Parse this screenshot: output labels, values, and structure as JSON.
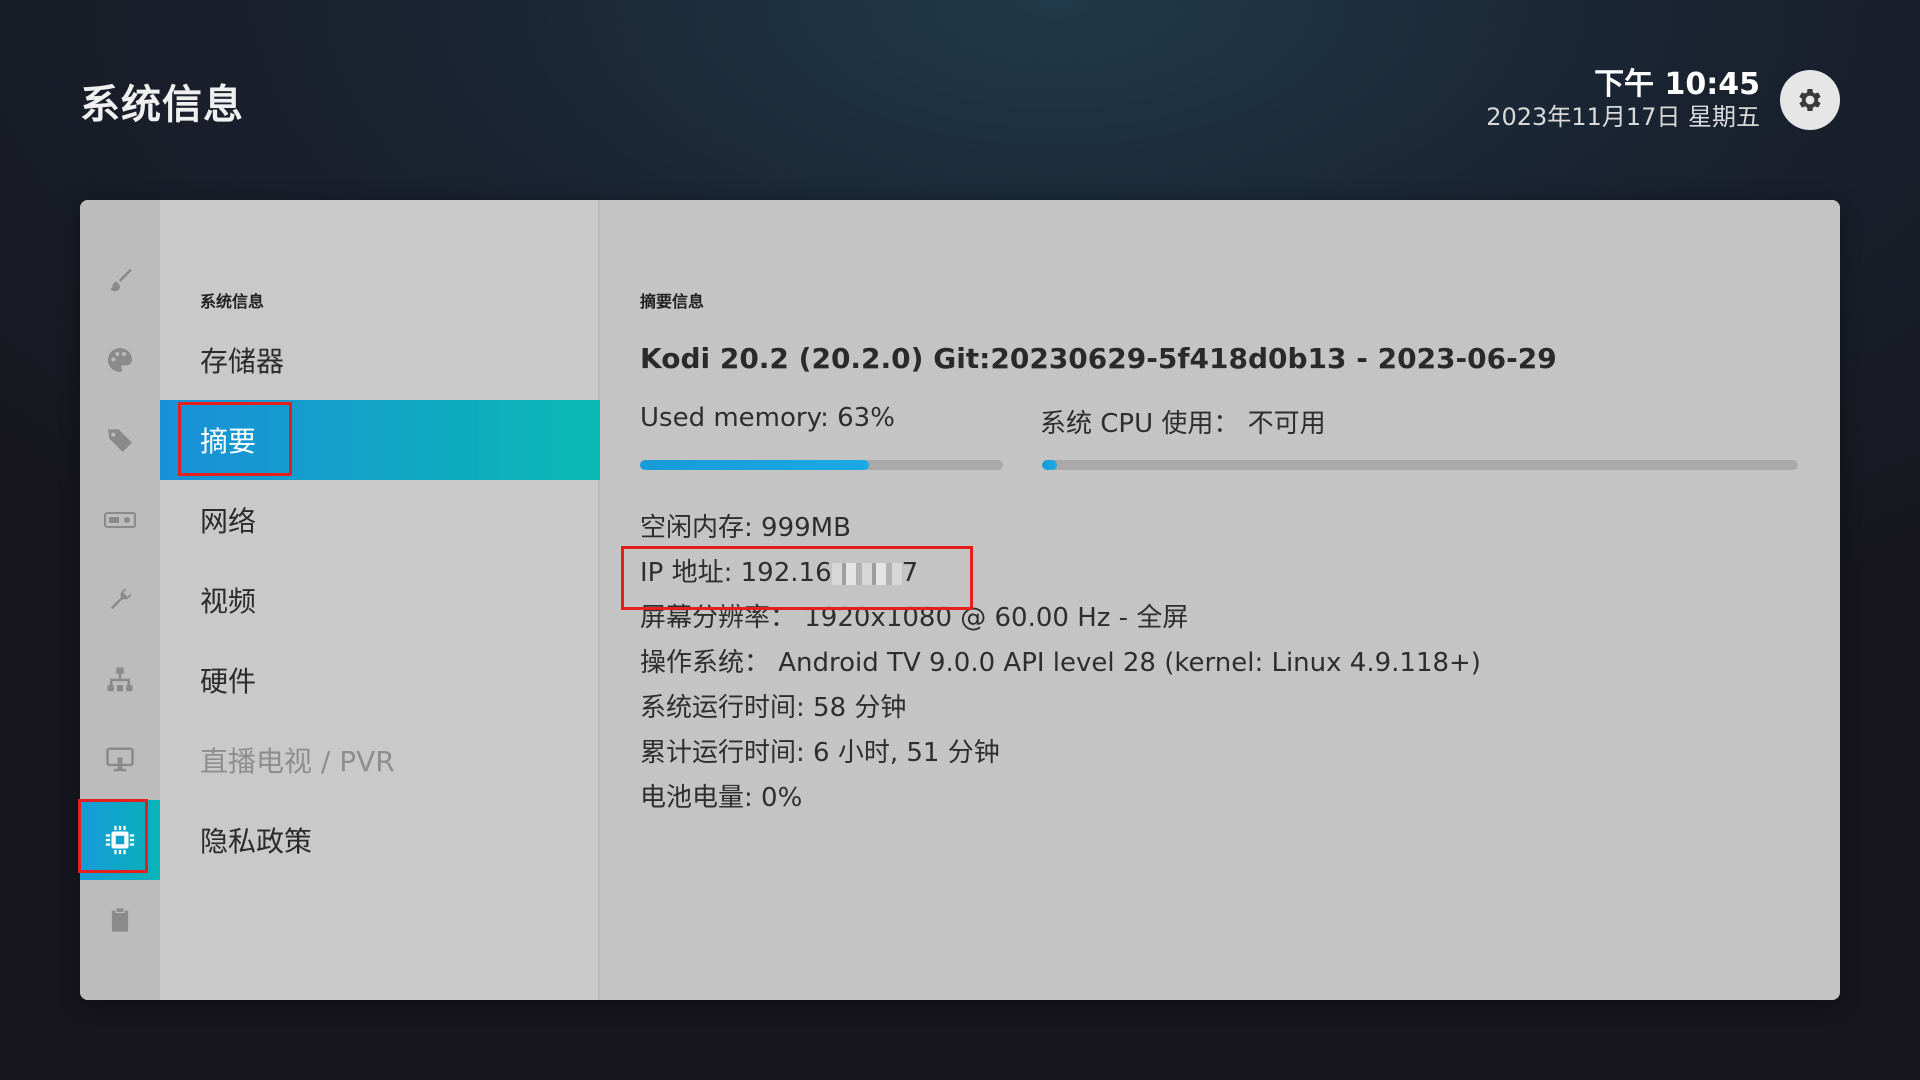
{
  "header": {
    "title": "系统信息",
    "time": "下午 10:45",
    "date": "2023年11月17日 星期五"
  },
  "iconbar": {
    "items": [
      {
        "icon": "paintbrush-icon"
      },
      {
        "icon": "palette-icon"
      },
      {
        "icon": "tags-icon"
      },
      {
        "icon": "media-icon"
      },
      {
        "icon": "wrench-icon"
      },
      {
        "icon": "network-icon"
      },
      {
        "icon": "display-icon"
      },
      {
        "icon": "chip-icon",
        "active": true
      },
      {
        "icon": "clipboard-icon"
      }
    ]
  },
  "menu": {
    "header": "系统信息",
    "items": [
      {
        "label": "存储器"
      },
      {
        "label": "摘要",
        "active": true
      },
      {
        "label": "网络"
      },
      {
        "label": "视频"
      },
      {
        "label": "硬件"
      },
      {
        "label": "直播电视 / PVR",
        "disabled": true
      },
      {
        "label": "隐私政策"
      }
    ]
  },
  "content": {
    "header": "摘要信息",
    "version": "Kodi 20.2 (20.2.0) Git:20230629-5f418d0b13 - 2023-06-29",
    "memory_label": "Used memory: 63%",
    "memory_used_fraction": 0.63,
    "cpu_label": "系统 CPU 使用： 不可用",
    "cpu_used_fraction": 0.02,
    "free_memory": "空闲内存: 999MB",
    "ip_prefix": "IP 地址: 192.16",
    "ip_suffix": "7",
    "resolution": "屏幕分辨率： 1920x1080 @ 60.00 Hz - 全屏",
    "os": "操作系统： Android TV 9.0.0 API level 28 (kernel: Linux 4.9.118+)",
    "uptime": "系统运行时间: 58 分钟",
    "total_uptime": "累计运行时间: 6 小时, 51 分钟",
    "battery": "电池电量: 0%"
  },
  "colors": {
    "accent_start": "#169ad8",
    "accent_end": "#0ab9b4",
    "highlight_box": "#e5201c"
  }
}
